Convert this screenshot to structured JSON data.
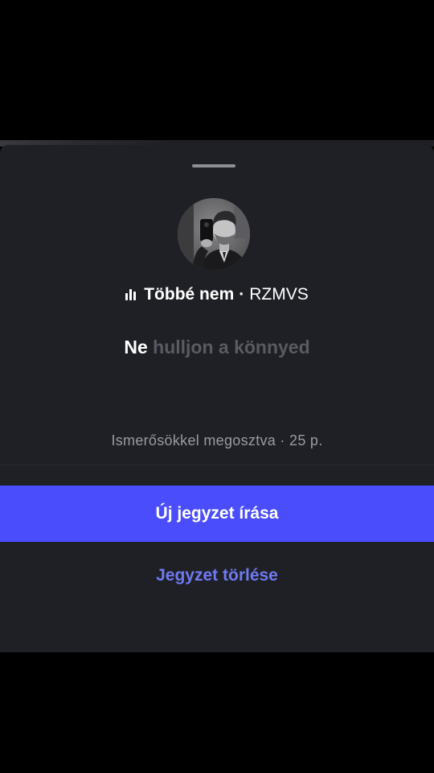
{
  "song": {
    "icon": "music-bars-icon",
    "title": "Többé nem",
    "separator": "·",
    "artist": "RZMVS"
  },
  "lyric": {
    "active": "Ne",
    "rest": "hulljon a könnyed"
  },
  "meta": {
    "text": "Ismerősökkel megosztva · 25 p."
  },
  "actions": {
    "new_note_label": "Új jegyzet írása",
    "delete_note_label": "Jegyzet törlése"
  },
  "colors": {
    "sheet_background": "#1f2025",
    "accent_button": "#4a4dfb",
    "link_text": "#6f79f2",
    "muted_text": "#9a9ba0",
    "dim_lyric": "#5a5b60"
  }
}
